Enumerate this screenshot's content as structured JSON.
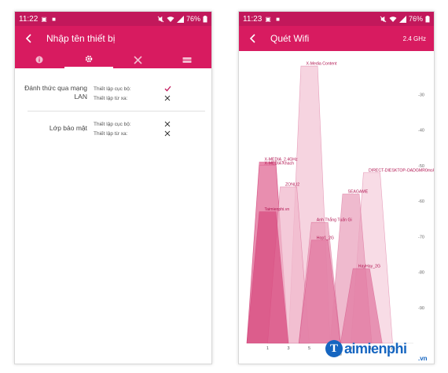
{
  "left_screen": {
    "status": {
      "time": "11:22",
      "notif_icons": "▣ ■",
      "battery": "76%"
    },
    "appbar": {
      "title": "Nhập tên thiết bị"
    },
    "tabs": [
      {
        "name": "info-icon",
        "active": false
      },
      {
        "name": "gear-icon",
        "active": true
      },
      {
        "name": "tools-icon",
        "active": false
      },
      {
        "name": "router-icon",
        "active": false
      }
    ],
    "settings": [
      {
        "label": "Đánh thức qua mạng LAN",
        "options": [
          {
            "text": "Thiết lập cục bộ:",
            "state": "check"
          },
          {
            "text": "Thiết lập từ xa:",
            "state": "x"
          }
        ]
      },
      {
        "label": "Lớp bảo mật",
        "options": [
          {
            "text": "Thiết lập cục bộ:",
            "state": "x"
          },
          {
            "text": "Thiết lập từ xa:",
            "state": "x"
          }
        ]
      }
    ]
  },
  "right_screen": {
    "status": {
      "time": "11:23",
      "notif_icons": "▣ ■",
      "battery": "76%"
    },
    "appbar": {
      "title": "Quét Wifi",
      "band": "2.4 GHz"
    },
    "pager": {
      "count": 2,
      "active": 1
    }
  },
  "chart_data": {
    "type": "area",
    "x_ticks": [
      "1",
      "3",
      "5",
      "7",
      "9",
      "11",
      "13"
    ],
    "y_ticks": [
      "-30",
      "-40",
      "-50",
      "-60",
      "-70",
      "-80",
      "-90"
    ],
    "xlim": [
      -1,
      15
    ],
    "ylim": [
      -100,
      -20
    ],
    "series": [
      {
        "name": "X-Media Content",
        "channel": 5,
        "signal": -22,
        "color": "#f3c6d6"
      },
      {
        "name": "X-MEDIA_2.4GHz",
        "channel": 1,
        "signal": -49,
        "color": "#e0608f"
      },
      {
        "name": "X-MEDIA Khach",
        "channel": 1,
        "signal": -50,
        "color": "#e890b0"
      },
      {
        "name": "DIRECT-DIESKTOP-OADGMR0msUW",
        "channel": 11,
        "signal": -52,
        "color": "#f5d0dd"
      },
      {
        "name": "ZONLI2",
        "channel": 3,
        "signal": -56,
        "color": "#f0b8cc"
      },
      {
        "name": "SEAGAME",
        "channel": 9,
        "signal": -58,
        "color": "#eaa3bd"
      },
      {
        "name": "Taimienphi.vn",
        "channel": 1,
        "signal": -63,
        "color": "#d84c80"
      },
      {
        "name": "Anh Thắng Tuấn Gi",
        "channel": 6,
        "signal": -66,
        "color": "#e9a0bb"
      },
      {
        "name": "Hop1_2G",
        "channel": 6,
        "signal": -71,
        "color": "#e27aa2"
      },
      {
        "name": "HayHay_2G",
        "channel": 10,
        "signal": -79,
        "color": "#e27aa2"
      }
    ]
  },
  "watermark": {
    "initial": "T",
    "text": "aimienphi",
    "sub": ".vn"
  }
}
